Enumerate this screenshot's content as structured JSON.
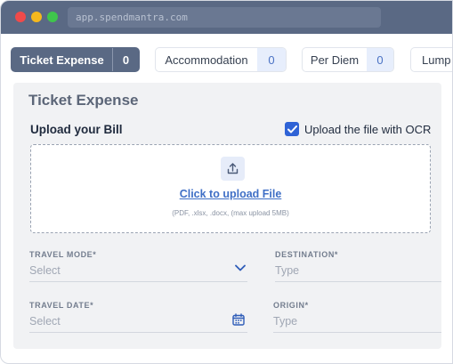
{
  "window": {
    "url": "app.spendmantra.com"
  },
  "tabs": [
    {
      "label": "Ticket Expense",
      "count": "0",
      "active": true
    },
    {
      "label": "Accommodation",
      "count": "0",
      "active": false
    },
    {
      "label": "Per Diem",
      "count": "0",
      "active": false
    },
    {
      "label": "Lump S",
      "count": "",
      "active": false
    }
  ],
  "panel": {
    "title": "Ticket Expense",
    "upload_heading": "Upload your Bill",
    "ocr_label": "Upload the file with OCR",
    "ocr_checked": true,
    "upload_link": "Click to upload File",
    "upload_hint": "(PDF, .xlsx, .docx, (max upload 5MB)"
  },
  "form": {
    "travel_mode": {
      "label": "TRAVEL MODE*",
      "placeholder": "Select",
      "icon": "chevron-down-icon"
    },
    "destination": {
      "label": "DESTINATION*",
      "placeholder": "Type"
    },
    "travel_date": {
      "label": "TRAVEL DATE*",
      "placeholder": "Select",
      "icon": "calendar-icon"
    },
    "origin": {
      "label": "ORIGIN*",
      "placeholder": "Type"
    }
  },
  "colors": {
    "titlebar": "#5a6984",
    "accent": "#2f63d6",
    "link": "#3f6fc6"
  }
}
